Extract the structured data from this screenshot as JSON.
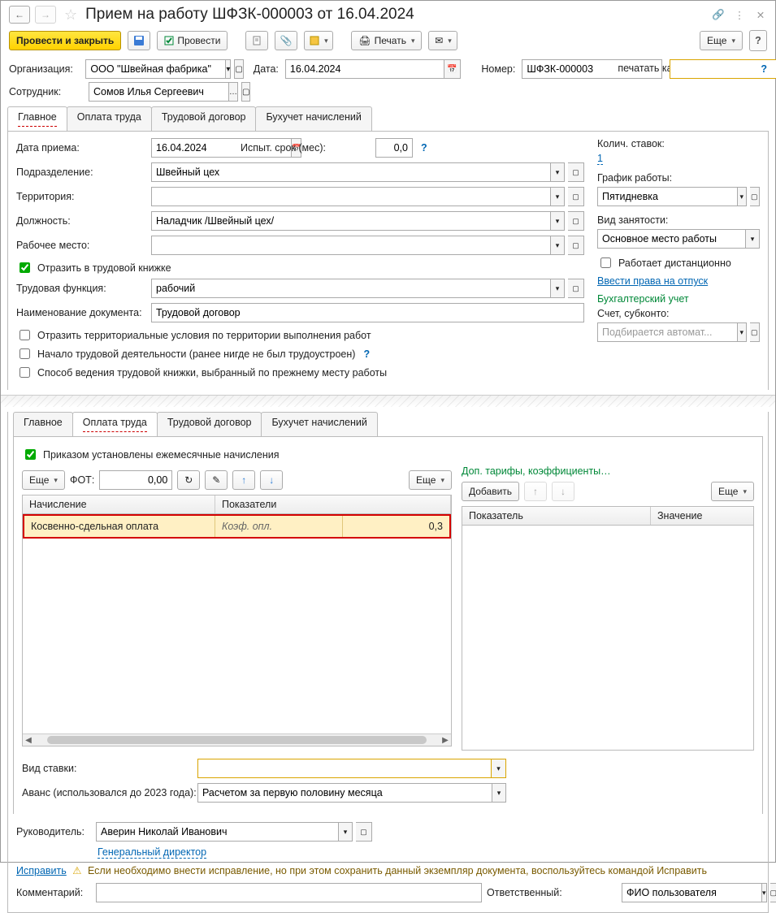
{
  "title": "Прием на работу ШФЗК-000003 от 16.04.2024",
  "toolbar": {
    "post_close": "Провести и закрыть",
    "post": "Провести",
    "print": "Печать",
    "more": "Еще"
  },
  "header": {
    "org_label": "Организация:",
    "org_value": "ООО \"Швейная фабрика\"",
    "date_label": "Дата:",
    "date_value": "16.04.2024",
    "num_label": "Номер:",
    "num_value": "ШФЗК-000003",
    "print_as_label": "печатать как:",
    "print_as_value": "",
    "emp_label": "Сотрудник:",
    "emp_value": "Сомов Илья Сергеевич"
  },
  "tabs1": [
    "Главное",
    "Оплата труда",
    "Трудовой договор",
    "Бухучет начислений"
  ],
  "main": {
    "hire_date_label": "Дата приема:",
    "hire_date": "16.04.2024",
    "trial_label": "Испыт. срок (мес):",
    "trial": "0,0",
    "dept_label": "Подразделение:",
    "dept": "Швейный цех",
    "terr_label": "Территория:",
    "terr": "",
    "pos_label": "Должность:",
    "pos": "Наладчик /Швейный цех/",
    "wplace_label": "Рабочее место:",
    "wplace": "",
    "workbook_chk": "Отразить в трудовой книжке",
    "func_label": "Трудовая функция:",
    "func": "рабочий",
    "docname_label": "Наименование документа:",
    "docname": "Трудовой договор",
    "chk_terr": "Отразить территориальные условия по территории выполнения работ",
    "chk_first": "Начало трудовой деятельности (ранее нигде не был трудоустроен)",
    "chk_method": "Способ ведения трудовой книжки, выбранный по прежнему месту работы"
  },
  "right1": {
    "stavok_label": "Колич. ставок:",
    "stavok": "1",
    "schedule_label": "График работы:",
    "schedule": "Пятидневка",
    "emp_type_label": "Вид занятости:",
    "emp_type": "Основное место работы",
    "remote_chk": "Работает дистанционно",
    "vac_link": "Ввести права на отпуск",
    "acct_label": "Бухгалтерский учет",
    "acct_sub": "Счет, субконто:",
    "acct_val": "Подбирается автомат..."
  },
  "tabs2": [
    "Главное",
    "Оплата труда",
    "Трудовой договор",
    "Бухучет начислений"
  ],
  "pay": {
    "monthly_chk": "Приказом установлены ежемесячные начисления",
    "more": "Еще",
    "fot_label": "ФОТ:",
    "fot": "0,00",
    "th1": "Начисление",
    "th2": "Показатели",
    "row_name": "Косвенно-сдельная оплата",
    "row_ind": "Коэф. опл.",
    "row_val": "0,3",
    "tariff_link": "Доп. тарифы, коэффициенты…",
    "add": "Добавить",
    "rth1": "Показатель",
    "rth2": "Значение",
    "rate_type_label": "Вид ставки:",
    "rate_type": "",
    "advance_label": "Аванс (использовался до 2023 года):",
    "advance": "Расчетом за первую половину месяца"
  },
  "footer": {
    "mgr_label": "Руководитель:",
    "mgr": "Аверин Николай Иванович",
    "mgr_pos": "Генеральный директор",
    "fix_link": "Исправить",
    "warn": "Если необходимо внести исправление, но при этом сохранить данный экземпляр документа, воспользуйтесь командой Исправить",
    "comment_label": "Комментарий:",
    "comment": "",
    "resp_label": "Ответственный:",
    "resp": "ФИО пользователя"
  }
}
